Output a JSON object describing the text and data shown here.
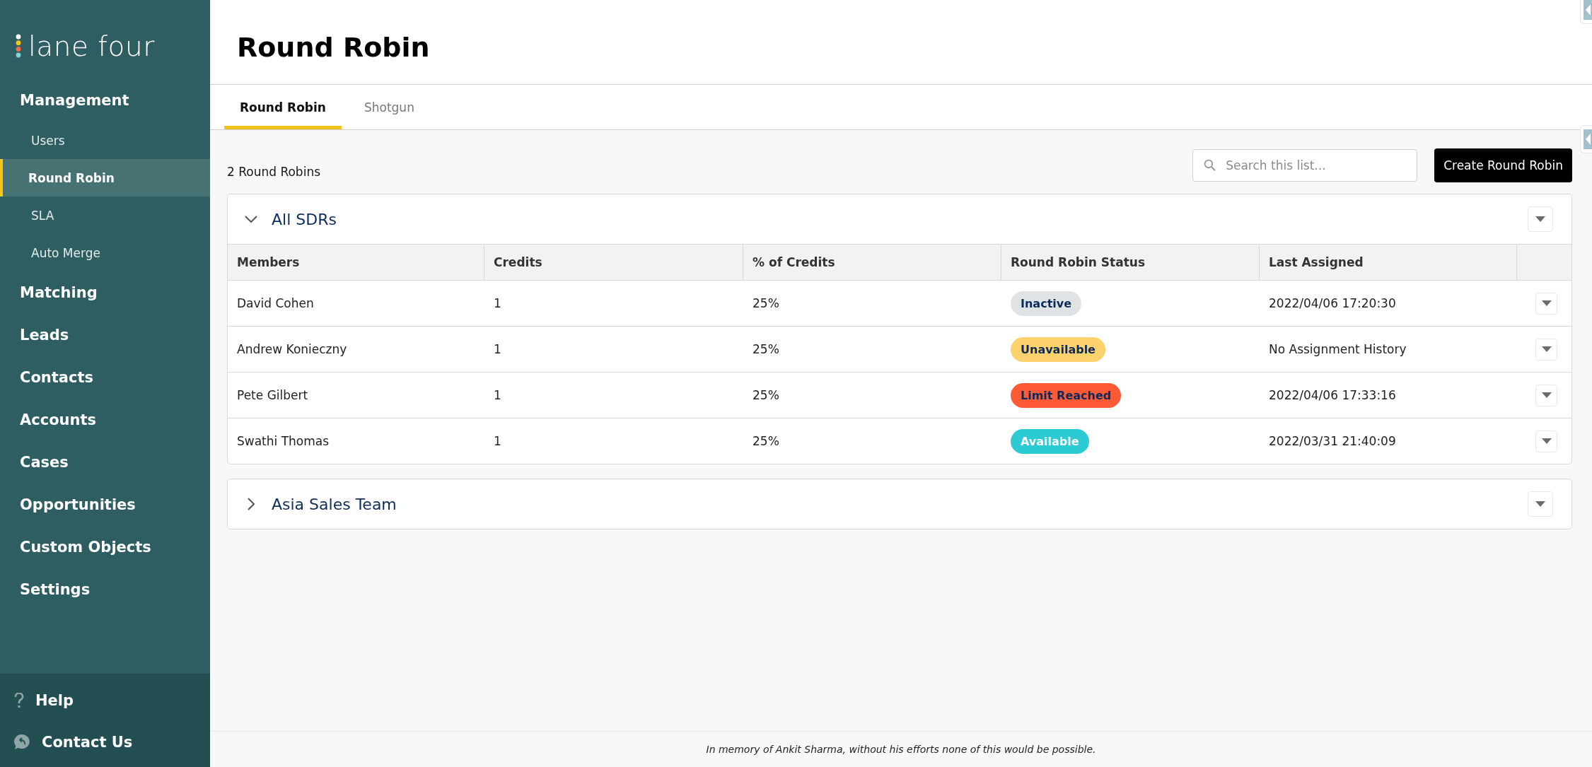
{
  "brand": {
    "name": "lane four"
  },
  "sidebar": {
    "sections": [
      {
        "label": "Management",
        "selected": false,
        "children": [
          {
            "label": "Users",
            "selected": false
          },
          {
            "label": "Round Robin",
            "selected": true
          },
          {
            "label": "SLA",
            "selected": false
          },
          {
            "label": "Auto Merge",
            "selected": false
          }
        ]
      },
      {
        "label": "Matching",
        "selected": false
      },
      {
        "label": "Leads",
        "selected": false
      },
      {
        "label": "Contacts",
        "selected": false
      },
      {
        "label": "Accounts",
        "selected": false
      },
      {
        "label": "Cases",
        "selected": false
      },
      {
        "label": "Opportunities",
        "selected": false
      },
      {
        "label": "Custom Objects",
        "selected": false
      },
      {
        "label": "Settings",
        "selected": false
      }
    ],
    "footer": [
      {
        "kind": "help",
        "label": "Help"
      },
      {
        "kind": "contact",
        "label": "Contact Us"
      }
    ]
  },
  "page": {
    "title": "Round Robin"
  },
  "tabs": [
    {
      "label": "Round Robin",
      "selected": true
    },
    {
      "label": "Shotgun",
      "selected": false
    }
  ],
  "toolbar": {
    "count": "2 Round Robins",
    "search": {
      "placeholder": "Search this list..."
    },
    "button": "Create Round Robin"
  },
  "groups": [
    {
      "title": "All SDRs",
      "expanded": true,
      "columns": [
        "Members",
        "Credits",
        "% of Credits",
        "Round Robin Status",
        "Last Assigned"
      ],
      "rows": [
        {
          "member": "David Cohen",
          "credits": "1",
          "percent": "25%",
          "status": {
            "label": "Inactive",
            "color": "#dfe3e6",
            "light_text": false
          },
          "last": "2022/04/06 17:20:30"
        },
        {
          "member": "Andrew Konieczny",
          "credits": "1",
          "percent": "25%",
          "status": {
            "label": "Unavailable",
            "color": "#fdd16b",
            "light_text": false
          },
          "last": "No Assignment History"
        },
        {
          "member": "Pete Gilbert",
          "credits": "1",
          "percent": "25%",
          "status": {
            "label": "Limit Reached",
            "color": "#ff5a36",
            "light_text": false
          },
          "last": "2022/04/06 17:33:16"
        },
        {
          "member": "Swathi Thomas",
          "credits": "1",
          "percent": "25%",
          "status": {
            "label": "Available",
            "color": "#2ccbd3",
            "light_text": true
          },
          "last": "2022/03/31 21:40:09"
        }
      ]
    },
    {
      "title": "Asia Sales Team",
      "expanded": false
    }
  ],
  "footer": {
    "text": "In memory of Ankit Sharma, without his efforts none of this would be possible."
  }
}
